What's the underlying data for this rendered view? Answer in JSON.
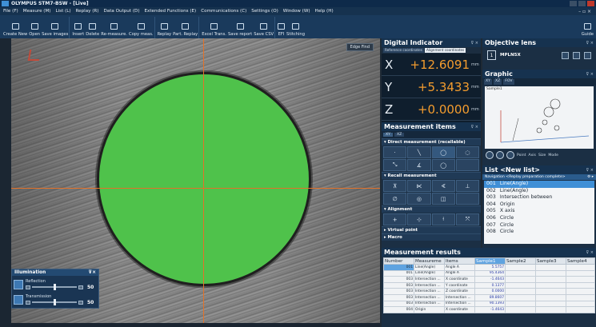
{
  "window": {
    "title": "OLYMPUS  STM7-BSW - [Live]"
  },
  "menu": [
    "File (F)",
    "Measure (M)",
    "List (L)",
    "Replay (R)",
    "Data Output (D)",
    "Extended Functions (E)",
    "Communications (C)",
    "Settings (O)",
    "Window (W)",
    "Help (H)"
  ],
  "toolbar": [
    "Create New",
    "Open",
    "Save images",
    "Insert",
    "Delete",
    "Re-measure.",
    "Copy meas.",
    "Replay",
    "Part. Replay",
    "Excel Trans.",
    "Save report",
    "Save CSV",
    "EFI",
    "Stitching"
  ],
  "toolbar_right": "Guide",
  "live": {
    "edge_button": "Edge Find"
  },
  "illumination": {
    "title": "Illumination",
    "reflection_label": "Reflection",
    "reflection_value": "50",
    "reflection_level": 0.5,
    "transmission_label": "Transmission",
    "transmission_value": "50",
    "transmission_level": 0.5
  },
  "digital": {
    "title": "Digital Indicator",
    "tabs": [
      "Reference coordinates",
      "Alignment coordinates"
    ],
    "x_label": "X",
    "x_value": "+12.6091",
    "y_label": "Y",
    "y_value": "+5.3433",
    "z_label": "Z",
    "z_value": "+0.0000",
    "unit": "mm"
  },
  "objective": {
    "title": "Objective lens",
    "lens_icon_text": "1",
    "lens_name": "MPLN5X"
  },
  "graphic": {
    "title": "Graphic",
    "tabs": [
      "XY",
      "XZ",
      "FOV"
    ],
    "canvas_label": "Sample1",
    "point_label": "Point",
    "axis_label": "Axis",
    "size_label": "Size",
    "mode_label": "Mode"
  },
  "measurement_items": {
    "title": "Measurement items",
    "tabs": [
      "XY",
      "XZ"
    ],
    "direct_label": "Direct measurement (recallable)",
    "recall_label": "Recall measurement",
    "alignment_label": "Alignment",
    "virtual_label": "Virtual point",
    "macro_label": "Macro"
  },
  "list": {
    "title": "List <New list>",
    "nav": "Navigation <Replay preparation complete>",
    "rows": [
      {
        "no": "001",
        "name": "Line(Angle)"
      },
      {
        "no": "002",
        "name": "Line(Angle)"
      },
      {
        "no": "003",
        "name": "Intersection between"
      },
      {
        "no": "004",
        "name": "Origin"
      },
      {
        "no": "005",
        "name": "X axis"
      },
      {
        "no": "006",
        "name": "Circle"
      },
      {
        "no": "007",
        "name": "Circle"
      },
      {
        "no": "008",
        "name": "Circle"
      }
    ]
  },
  "results": {
    "title": "Measurement results",
    "headers": [
      "Number",
      "Measureme",
      "Items",
      "Sample1",
      "Sample2",
      "Sample3",
      "Sample4"
    ],
    "rows": [
      {
        "n": "001",
        "m": "Line(Angle)",
        "i": "Angle A",
        "v": "5.5757"
      },
      {
        "n": "001",
        "m": "Line(Angle)",
        "i": "Angle A",
        "v": "95.4364"
      },
      {
        "n": "003",
        "m": "Intersection ...",
        "i": "X coordinate",
        "v": "-1.4643"
      },
      {
        "n": "003",
        "m": "Intersection ...",
        "i": "Y coordinate",
        "v": "0.1377"
      },
      {
        "n": "003",
        "m": "Intersection ...",
        "i": "Z coordinate",
        "v": "0.0000"
      },
      {
        "n": "003",
        "m": "Intersection ...",
        "i": "Intersection ...",
        "v": "89.8607"
      },
      {
        "n": "003",
        "m": "Intersection ...",
        "i": "Intersection ...",
        "v": "90.1393"
      },
      {
        "n": "004",
        "m": "Origin",
        "i": "X coordinate",
        "v": "-1.4643"
      }
    ]
  }
}
